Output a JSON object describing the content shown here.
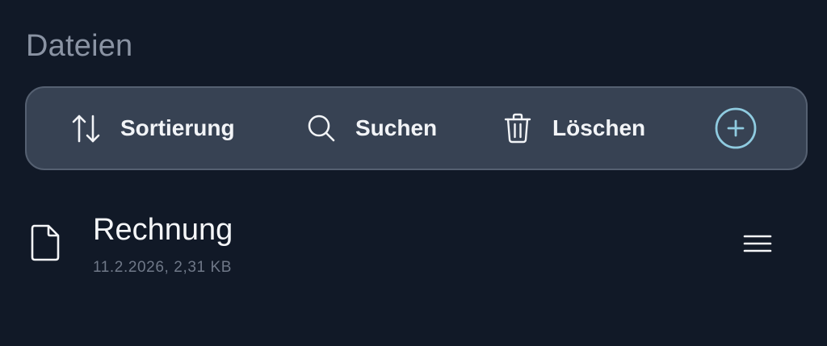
{
  "section": {
    "title": "Dateien"
  },
  "toolbar": {
    "sort_label": "Sortierung",
    "search_label": "Suchen",
    "delete_label": "Löschen",
    "icons": {
      "sort": "sort-arrows-icon",
      "search": "search-icon",
      "delete": "trash-icon",
      "add": "plus-circle-icon"
    }
  },
  "files": [
    {
      "name": "Rechnung",
      "meta": "11.2.2026, 2,31 KB",
      "icon": "document-icon",
      "menu_icon": "hamburger-menu-icon"
    }
  ],
  "colors": {
    "background": "#111927",
    "toolbar_bg": "#374253",
    "toolbar_border": "#556071",
    "accent": "#8fcbe0",
    "title_text": "#8a93a3",
    "meta_text": "#6f7888"
  }
}
